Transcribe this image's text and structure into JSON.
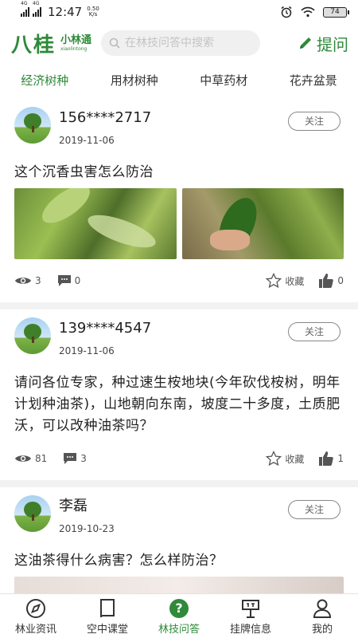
{
  "status_bar": {
    "network_left": "4G",
    "network_right": "4G",
    "time": "12:47",
    "speed_value": "0.50",
    "speed_unit": "K/s",
    "battery": "74"
  },
  "header": {
    "logo_main": "八桂",
    "logo_sub_cn": "小林通",
    "logo_sub_en": "xiaolintong",
    "search_placeholder": "在林技问答中搜索",
    "ask_label": "提问"
  },
  "categories": [
    {
      "label": "经济树种",
      "active": true
    },
    {
      "label": "用材树种",
      "active": false
    },
    {
      "label": "中草药材",
      "active": false
    },
    {
      "label": "花卉盆景",
      "active": false
    }
  ],
  "posts": [
    {
      "user": "156****2717",
      "date": "2019-11-06",
      "follow_label": "关注",
      "text": "这个沉香虫害怎么防治",
      "views": "3",
      "comments": "0",
      "collect_label": "收藏",
      "likes": "0"
    },
    {
      "user": "139****4547",
      "date": "2019-11-06",
      "follow_label": "关注",
      "text": "请问各位专家，种过速生桉地块(今年砍伐桉树，明年计划种油茶)，山地朝向东南，坡度二十多度，土质肥沃，可以改种油茶吗？",
      "views": "81",
      "comments": "3",
      "collect_label": "收藏",
      "likes": "1"
    },
    {
      "user": "李磊",
      "date": "2019-10-23",
      "follow_label": "关注",
      "text": "这油茶得什么病害？怎么样防治？"
    }
  ],
  "tabs": [
    {
      "label": "林业资讯",
      "icon": "compass-icon",
      "active": false
    },
    {
      "label": "空中课堂",
      "icon": "book-icon",
      "active": false
    },
    {
      "label": "林技问答",
      "icon": "question-icon",
      "active": true
    },
    {
      "label": "挂牌信息",
      "icon": "signboard-icon",
      "active": false
    },
    {
      "label": "我的",
      "icon": "user-icon",
      "active": false
    }
  ],
  "colors": {
    "accent": "#2f8a3a",
    "text": "#222222",
    "muted": "#666666"
  }
}
